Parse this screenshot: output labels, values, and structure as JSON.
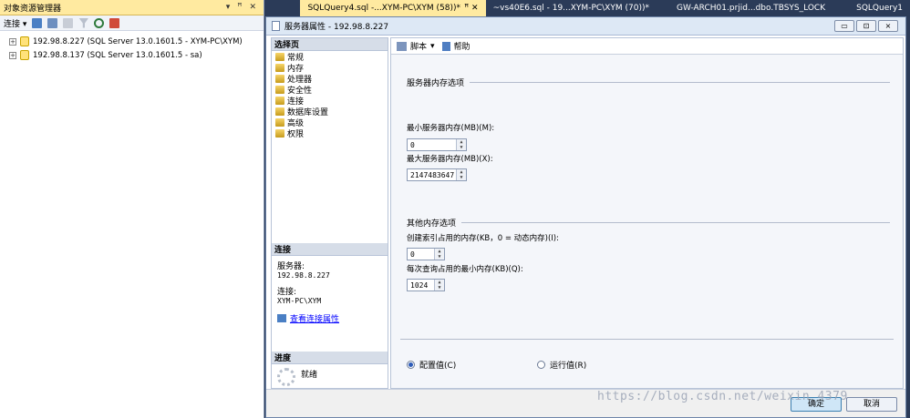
{
  "object_explorer": {
    "title": "对象资源管理器",
    "pin_controls": [
      "▾",
      "ꟸ",
      "✕"
    ],
    "toolbar_connect": "连接 ▾",
    "servers": [
      {
        "label": "192.98.8.227 (SQL Server 13.0.1601.5 - XYM-PC\\XYM)"
      },
      {
        "label": "192.98.8.137 (SQL Server 13.0.1601.5 - sa)"
      }
    ]
  },
  "tabs": [
    {
      "label": "SQLQuery4.sql -...XYM-PC\\XYM (58))*",
      "suffix": "ꟸ ✕",
      "active": false
    },
    {
      "label": "~vs40E6.sql - 19...XYM-PC\\XYM (70))*",
      "suffix": "",
      "active": false
    },
    {
      "label": "GW-ARCH01.prjid...dbo.TBSYS_LOCK",
      "suffix": "",
      "active": false
    },
    {
      "label": "SQLQuery1",
      "suffix": "",
      "active": false
    }
  ],
  "dialog": {
    "title": "服务器属性 - 192.98.8.227",
    "win_buttons": [
      "▭",
      "⊡",
      "⨯"
    ],
    "select_page_header": "选择页",
    "pages": [
      "常规",
      "内存",
      "处理器",
      "安全性",
      "连接",
      "数据库设置",
      "高级",
      "权限"
    ],
    "connection_header": "连接",
    "server_label": "服务器:",
    "server_value": "192.98.8.227",
    "connection_label": "连接:",
    "connection_value": "XYM-PC\\XYM",
    "view_conn_link": "查看连接属性",
    "progress_header": "进度",
    "progress_status": "就绪",
    "toolbar_script": "脚本",
    "toolbar_script_arrow": "▾",
    "toolbar_help": "帮助",
    "memory_group": "服务器内存选项",
    "min_mem_label": "最小服务器内存(MB)(M):",
    "min_mem_value": "0",
    "max_mem_label": "最大服务器内存(MB)(X):",
    "max_mem_value": "2147483647",
    "other_group": "其他内存选项",
    "index_mem_label": "创建索引占用的内存(KB，0 = 动态内存)(I):",
    "index_mem_value": "0",
    "query_mem_label": "每次查询占用的最小内存(KB)(Q):",
    "query_mem_value": "1024",
    "radio_config": "配置值(C)",
    "radio_running": "运行值(R)",
    "ok_button": "确定",
    "cancel_button": "取消"
  },
  "watermark": "https://blog.csdn.net/weixin_4379",
  "colors": {
    "accent": "#ffeaa0",
    "frame": "#2b3b58"
  }
}
